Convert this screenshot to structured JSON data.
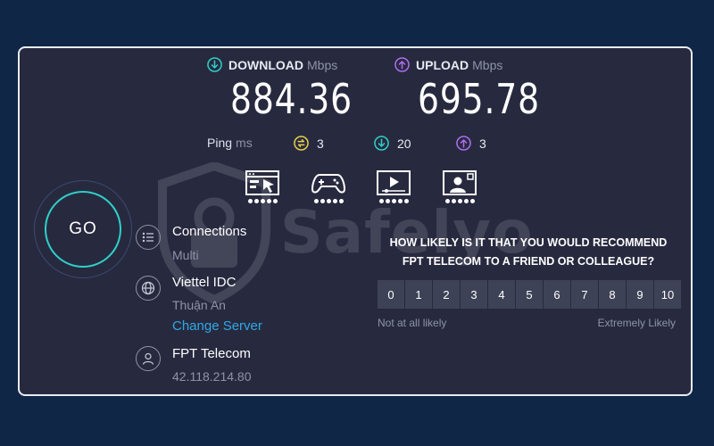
{
  "colors": {
    "background": "#0f2647",
    "panel": "#272a3f",
    "accent_teal": "#2fd0c8",
    "accent_purple": "#b06cf0",
    "link": "#2fa8e6",
    "ping_yellow": "#e8cf4a"
  },
  "watermark": {
    "text": "Safelyo"
  },
  "download": {
    "label": "DOWNLOAD",
    "unit": "Mbps",
    "value": "884.36",
    "icon": "download-arrow-icon"
  },
  "upload": {
    "label": "UPLOAD",
    "unit": "Mbps",
    "value": "695.78",
    "icon": "upload-arrow-icon"
  },
  "ping": {
    "label": "Ping",
    "unit": "ms",
    "idle": "3",
    "download": "20",
    "upload": "3"
  },
  "go": {
    "label": "GO"
  },
  "connections": {
    "title": "Connections",
    "value": "Multi",
    "icon": "connections-icon"
  },
  "server": {
    "name": "Viettel IDC",
    "location": "Thuận An",
    "change_label": "Change Server",
    "icon": "globe-icon"
  },
  "provider": {
    "name": "FPT Telecom",
    "ip": "42.118.214.80",
    "icon": "user-icon"
  },
  "activities": [
    {
      "icon": "web-browsing-icon"
    },
    {
      "icon": "gaming-controller-icon"
    },
    {
      "icon": "video-streaming-icon"
    },
    {
      "icon": "video-call-icon"
    }
  ],
  "survey": {
    "question_line1": "HOW LIKELY IS IT THAT YOU WOULD RECOMMEND",
    "question_line2": "FPT TELECOM TO A FRIEND OR COLLEAGUE?",
    "scale": [
      "0",
      "1",
      "2",
      "3",
      "4",
      "5",
      "6",
      "7",
      "8",
      "9",
      "10"
    ],
    "low_label": "Not at all likely",
    "high_label": "Extremely Likely"
  }
}
